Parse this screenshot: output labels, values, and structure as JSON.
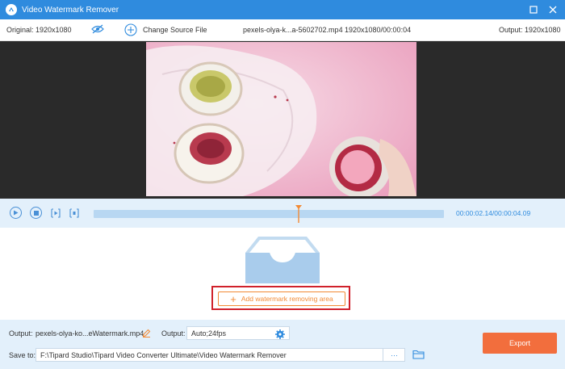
{
  "window": {
    "title": "Video Watermark Remover"
  },
  "infobar": {
    "original_label": "Original: 1920x1080",
    "change_source_label": "Change Source File",
    "file_name": "pexels-olya-k...a-5602702.mp4",
    "file_meta": "1920x1080/00:00:04",
    "output_label": "Output: 1920x1080"
  },
  "player": {
    "current_time": "00:00:02.14",
    "separator": "/",
    "total_time": "00:00:04.09",
    "progress": 0.585
  },
  "main": {
    "add_area_label": "Add watermark removing area"
  },
  "bottom": {
    "output_label": "Output:",
    "output_file": "pexels-olya-ko...eWatermark.mp4",
    "format_label": "Output:",
    "format_value": "Auto;24fps",
    "save_to_label": "Save to:",
    "save_path": "F:\\Tipard Studio\\Tipard Video Converter Ultimate\\Video Watermark Remover",
    "browse_label": "···",
    "export_label": "Export"
  },
  "colors": {
    "accent": "#2f8bde",
    "export": "#f26e3d",
    "add_button": "#f28a35",
    "highlight": "#d0212b"
  }
}
